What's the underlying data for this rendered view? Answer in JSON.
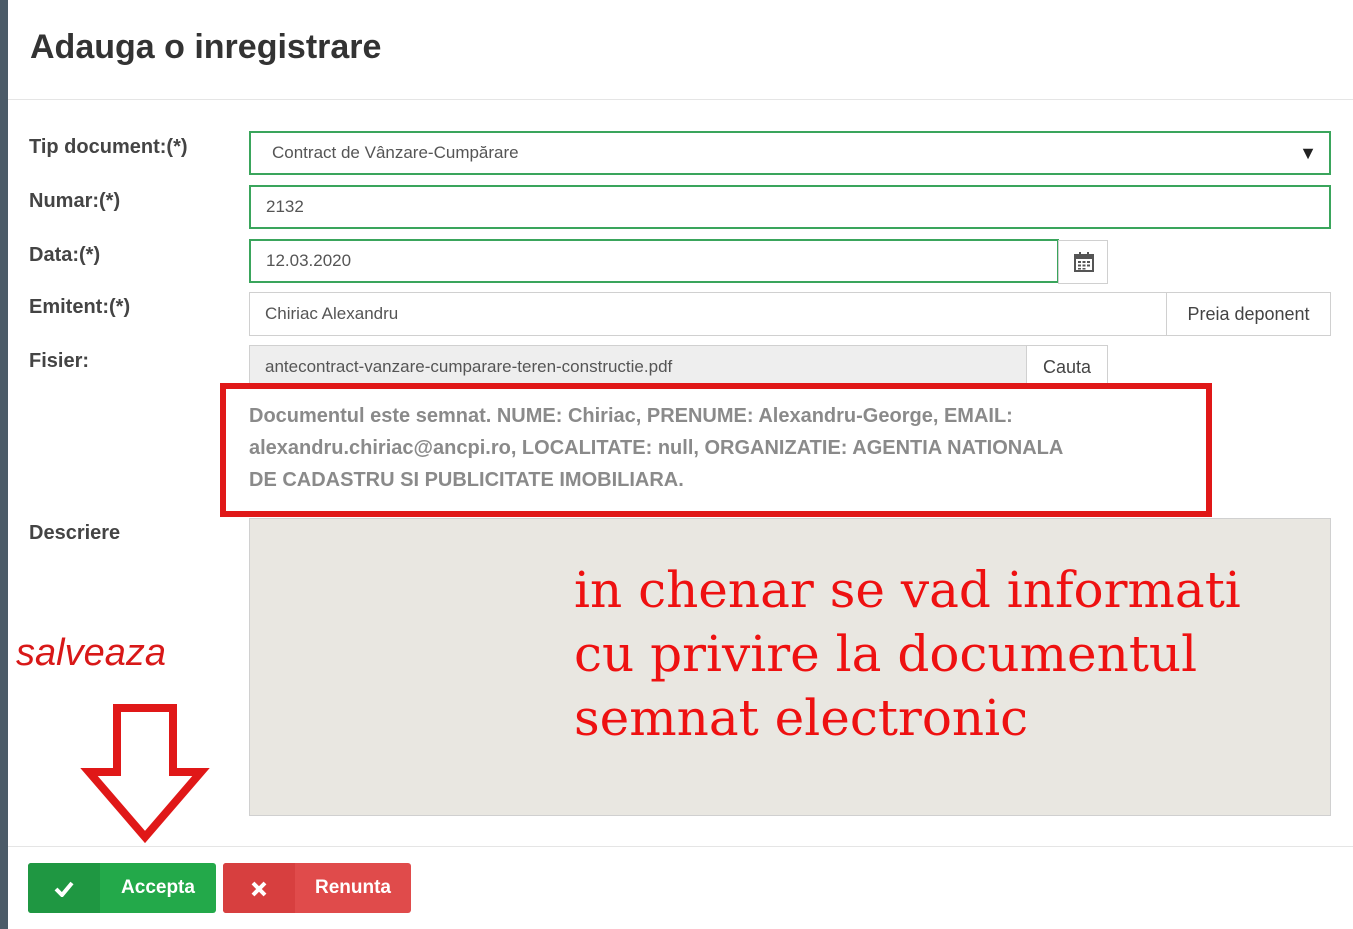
{
  "dialog": {
    "title": "Adauga o inregistrare"
  },
  "form": {
    "tip_document": {
      "label": "Tip document:(*)",
      "value": "Contract de Vânzare-Cumpărare",
      "arrow": "▼"
    },
    "numar": {
      "label": "Numar:(*)",
      "value": "2132"
    },
    "data": {
      "label": "Data:(*)",
      "value": "12.03.2020",
      "icon": "calendar-icon"
    },
    "emitent": {
      "label": "Emitent:(*)",
      "value": "Chiriac Alexandru",
      "button": "Preia deponent"
    },
    "fisier": {
      "label": "Fisier:",
      "value": "antecontract-vanzare-cumparare-teren-constructie.pdf",
      "button": "Cauta"
    },
    "signature_info": [
      "Documentul este semnat. NUME: Chiriac, PRENUME: Alexandru-George, EMAIL:",
      "alexandru.chiriac@ancpi.ro, LOCALITATE: null, ORGANIZATIE: AGENTIA NATIONALA",
      "DE CADASTRU SI PUBLICITATE IMOBILIARA."
    ],
    "descriere": {
      "label": "Descriere",
      "value": ""
    }
  },
  "annotations": {
    "box_note": [
      "in chenar se vad informati",
      "cu privire la documentul",
      "semnat electronic"
    ],
    "save_note": "salveaza",
    "box_color": "#e01818",
    "text_color": "#ee1111"
  },
  "footer": {
    "accept_label": "Accepta",
    "accept_icon": "check-icon",
    "cancel_label": "Renunta",
    "cancel_icon": "close-icon",
    "accept_color": "#23a94a",
    "cancel_color": "#e04b4b"
  }
}
